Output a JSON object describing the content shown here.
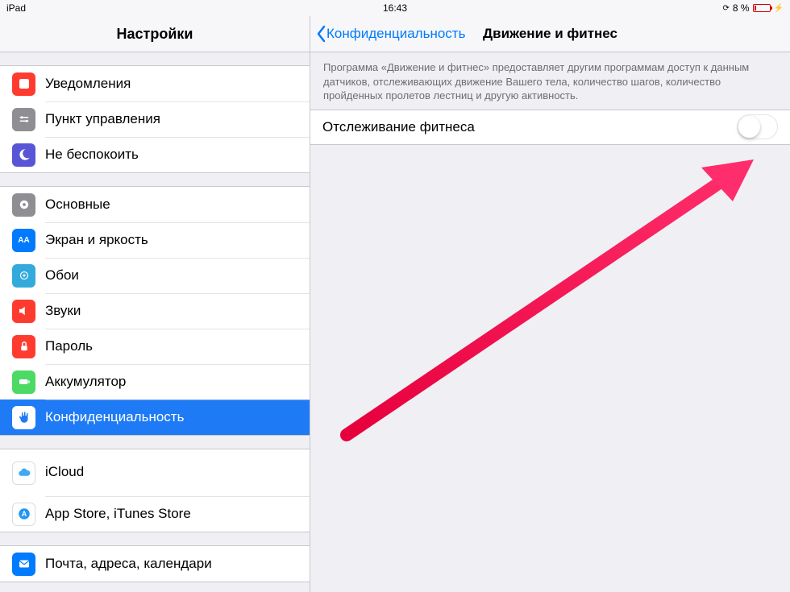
{
  "statusbar": {
    "device": "iPad",
    "time": "16:43",
    "battery": "8 %"
  },
  "sidebar": {
    "title": "Настройки",
    "group1": [
      {
        "id": "notifications",
        "label": "Уведомления"
      },
      {
        "id": "control-center",
        "label": "Пункт управления"
      },
      {
        "id": "dnd",
        "label": "Не беспокоить"
      }
    ],
    "group2": [
      {
        "id": "general",
        "label": "Основные"
      },
      {
        "id": "display",
        "label": "Экран и яркость"
      },
      {
        "id": "wallpaper",
        "label": "Обои"
      },
      {
        "id": "sounds",
        "label": "Звуки"
      },
      {
        "id": "passcode",
        "label": "Пароль"
      },
      {
        "id": "battery",
        "label": "Аккумулятор"
      },
      {
        "id": "privacy",
        "label": "Конфиденциальность",
        "selected": true
      }
    ],
    "group3": [
      {
        "id": "icloud",
        "label": "iCloud",
        "sub": " "
      },
      {
        "id": "stores",
        "label": "App Store, iTunes Store"
      }
    ],
    "group4": [
      {
        "id": "mail",
        "label": "Почта, адреса, календари"
      }
    ]
  },
  "detail": {
    "back": "Конфиденциальность",
    "title": "Движение и фитнес",
    "explain": "Программа «Движение и фитнес» предоставляет другим программам доступ к данным датчиков, отслеживающих движение Вашего тела, количество шагов, количество пройденных пролетов лестниц и другую активность.",
    "setting": {
      "label": "Отслеживание фитнеса",
      "on": false
    }
  }
}
